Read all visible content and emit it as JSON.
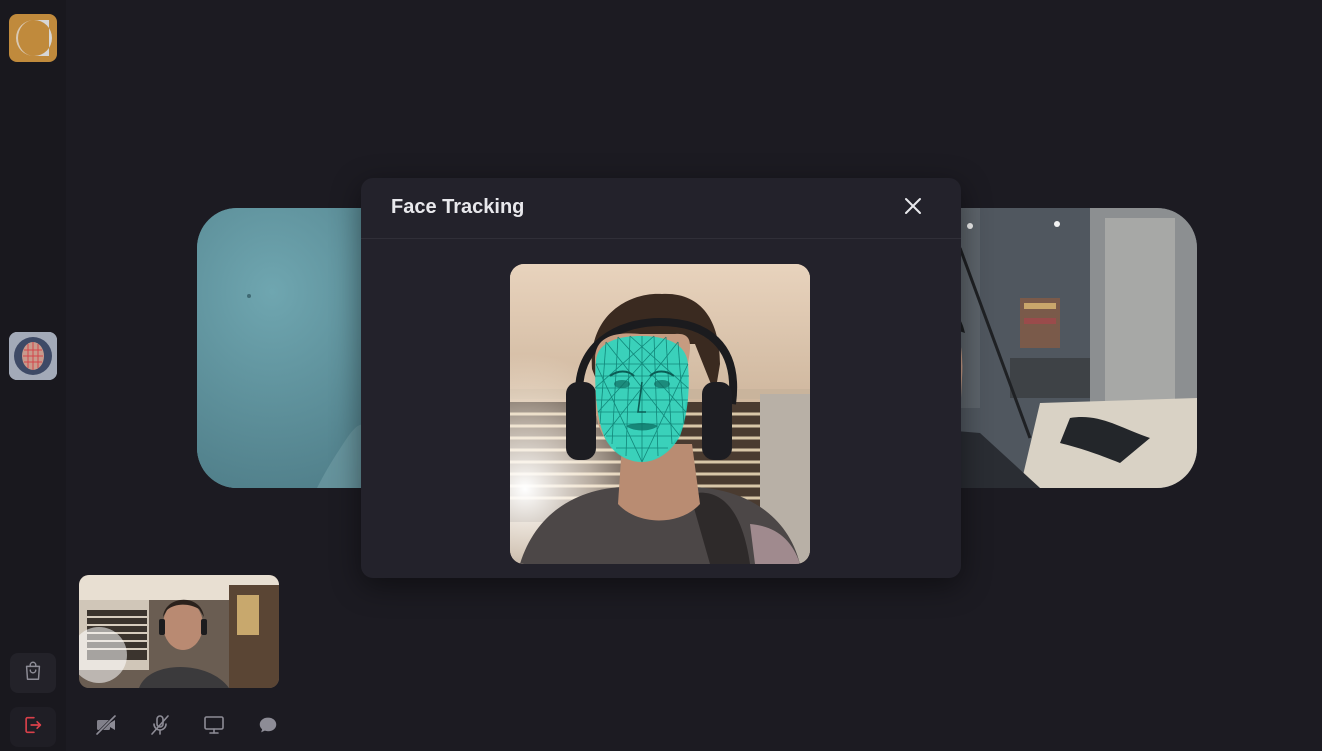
{
  "modal": {
    "title": "Face Tracking",
    "close_icon": "close-icon"
  },
  "sidebar": {
    "logo_icon": "app-logo-icon",
    "app_tile_icon": "face-tracking-app-icon",
    "shop_icon": "shopping-bag-icon",
    "leave_icon": "leave-call-icon"
  },
  "toolbar": {
    "buttons": [
      {
        "icon": "camera-off-icon"
      },
      {
        "icon": "microphone-off-icon"
      },
      {
        "icon": "screen-share-icon"
      },
      {
        "icon": "chat-icon"
      }
    ]
  },
  "colors": {
    "background": "#1c1b22",
    "modal_background": "#23222b",
    "mesh": "#2de0c8",
    "leave_accent": "#d9404a",
    "logo_tile": "#c08a3c"
  }
}
